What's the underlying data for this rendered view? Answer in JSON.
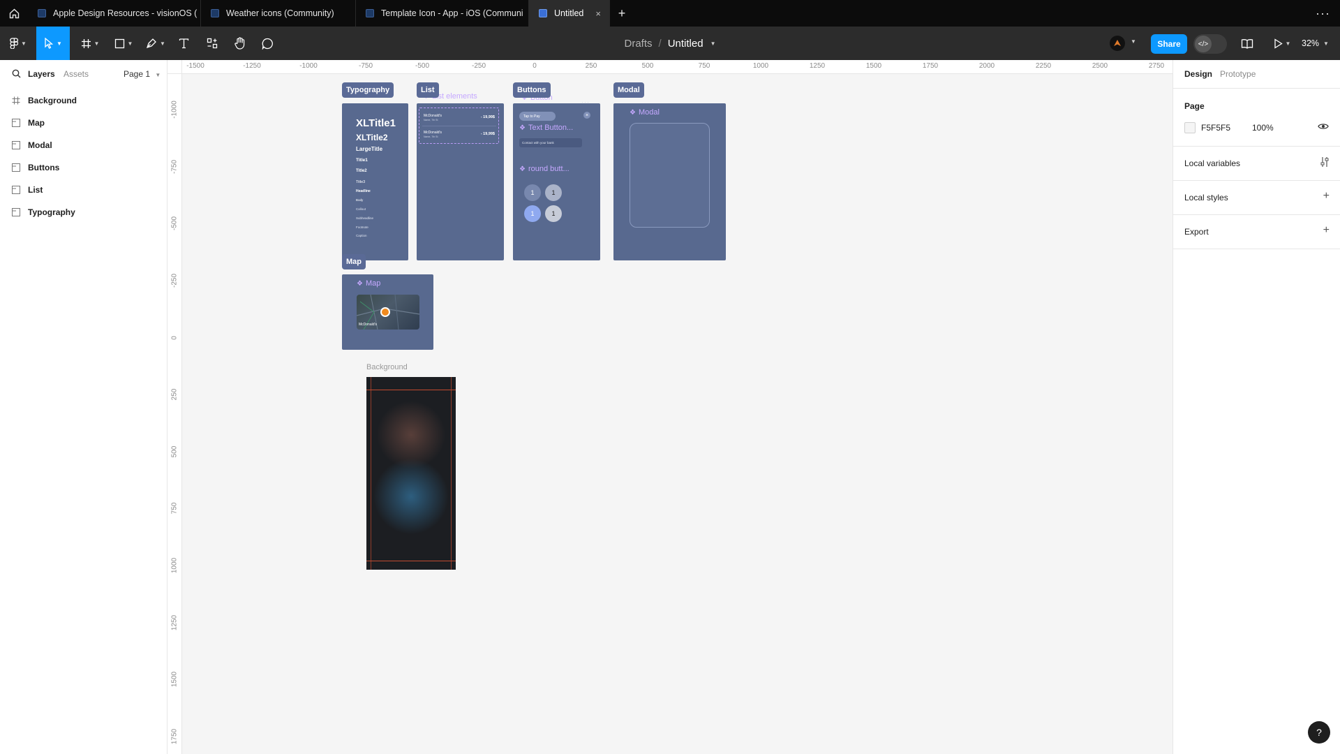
{
  "browser_tabs": [
    {
      "label": "Apple Design Resources - visionOS (",
      "active": false
    },
    {
      "label": "Weather icons (Community)",
      "active": false
    },
    {
      "label": "Template Icon - App - iOS (Communi",
      "active": false
    },
    {
      "label": "Untitled",
      "active": true,
      "close": "×"
    }
  ],
  "tab_add": "+",
  "tab_more": "···",
  "toolbar": {
    "breadcrumb_parent": "Drafts",
    "breadcrumb_sep": "/",
    "file_name": "Untitled",
    "share_label": "Share",
    "zoom_label": "32%"
  },
  "left_panel": {
    "tabs": [
      "Layers",
      "Assets"
    ],
    "page_selector": "Page 1",
    "layers": [
      {
        "name": "Background",
        "icon": "frame-icon"
      },
      {
        "name": "Map",
        "icon": "section-icon"
      },
      {
        "name": "Modal",
        "icon": "section-icon"
      },
      {
        "name": "Buttons",
        "icon": "section-icon"
      },
      {
        "name": "List",
        "icon": "section-icon"
      },
      {
        "name": "Typography",
        "icon": "section-icon"
      }
    ]
  },
  "rulers": {
    "top": [
      "-1500",
      "-1250",
      "-1000",
      "-750",
      "-500",
      "-250",
      "0",
      "250",
      "500",
      "750",
      "1000",
      "1250",
      "1500",
      "1750",
      "2000",
      "2250",
      "2500",
      "2750"
    ],
    "left": [
      "-1000",
      "-750",
      "-500",
      "-250",
      "0",
      "250",
      "500",
      "750",
      "1000",
      "1250",
      "1500",
      "1750"
    ]
  },
  "canvas": {
    "sections": {
      "typography": "Typography",
      "list": "List",
      "buttons": "Buttons",
      "modal": "Modal",
      "map": "Map"
    },
    "typography_styles": [
      "XLTitle1",
      "XLTitle2",
      "LargeTitle",
      "Title1",
      "Title2",
      "Title3",
      "Headline",
      "Body",
      "Callout",
      "Subheadline",
      "Footnote",
      "Caption"
    ],
    "list": {
      "component": "List elements",
      "rows": [
        {
          "title": "McDonald's",
          "subtitle": "Name, 7th St",
          "value": "- 19,99$"
        },
        {
          "title": "McDonald's",
          "subtitle": "Name, 7th St",
          "value": "- 19,99$"
        }
      ]
    },
    "buttons": {
      "top_component": "Button",
      "pill_label": "Tap to Pay",
      "text_button_component": "Text Button...",
      "text_field": "Contact with your bank",
      "round_component": "round butt...",
      "round_values": [
        "1",
        "1",
        "1",
        "1"
      ]
    },
    "modal_component": "Modal",
    "map_component": "Map",
    "map_pin_label": "McDonald's",
    "background_caption": "Background"
  },
  "right_panel": {
    "tabs": [
      "Design",
      "Prototype"
    ],
    "page_heading": "Page",
    "page_color": "F5F5F5",
    "page_opacity": "100%",
    "local_variables": "Local variables",
    "local_styles": "Local styles",
    "export": "Export"
  },
  "help_label": "?",
  "colors": {
    "accent": "#0d99ff",
    "section_fill": "#58698f",
    "component_purple": "#c5a8ff",
    "page_bg": "#F5F5F5"
  }
}
